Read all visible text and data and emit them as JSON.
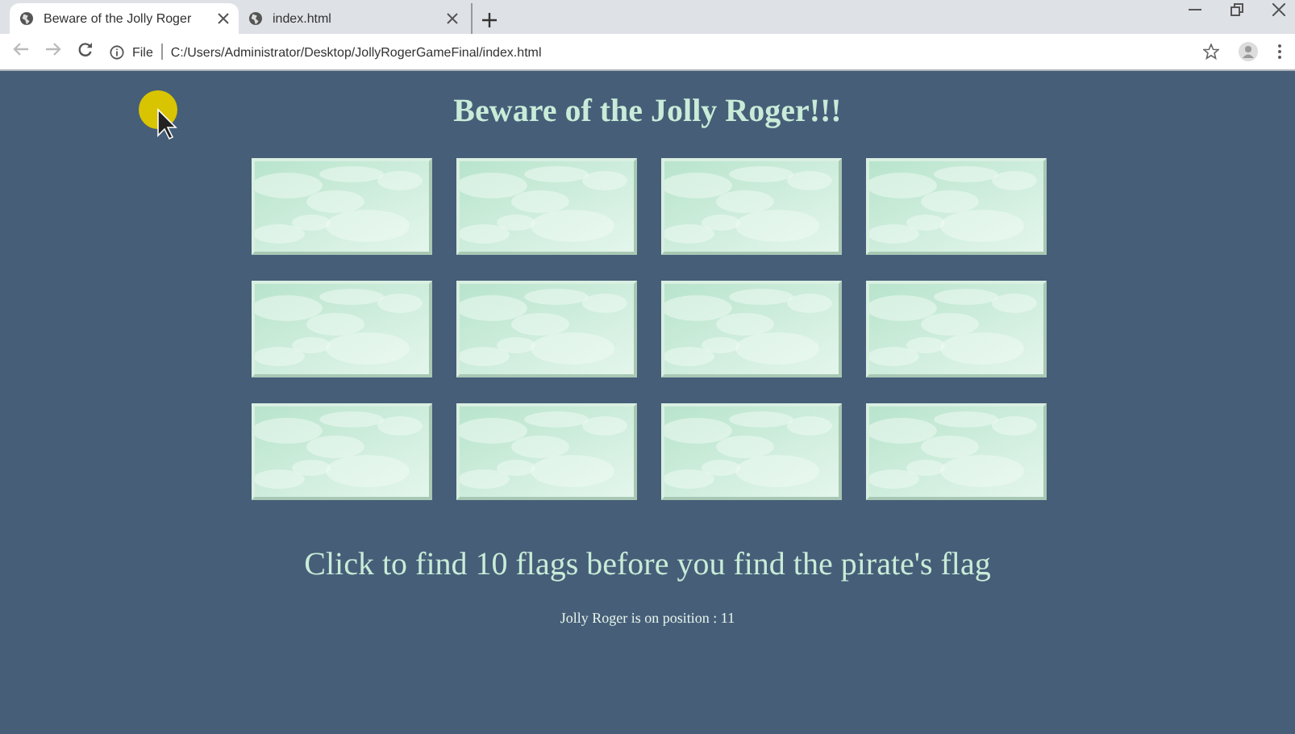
{
  "tabs": [
    {
      "title": "Beware of the Jolly Roger",
      "selected": true
    },
    {
      "title": "index.html",
      "selected": false
    }
  ],
  "address_bar": {
    "scheme_label": "File",
    "url": "C:/Users/Administrator/Desktop/JollyRogerGameFinal/index.html"
  },
  "page": {
    "heading": "Beware of the Jolly Roger!!!",
    "cards": [
      {
        "kind": "hidden"
      },
      {
        "kind": "hidden"
      },
      {
        "kind": "hidden"
      },
      {
        "kind": "hidden"
      },
      {
        "kind": "hidden"
      },
      {
        "kind": "hidden"
      },
      {
        "kind": "hidden"
      },
      {
        "kind": "hidden"
      },
      {
        "kind": "hidden"
      },
      {
        "kind": "hidden"
      },
      {
        "kind": "hidden"
      },
      {
        "kind": "hidden"
      }
    ],
    "instruction": "Click to find 10 flags before you find the pirate's flag",
    "status": "Jolly Roger is on position : 11"
  }
}
